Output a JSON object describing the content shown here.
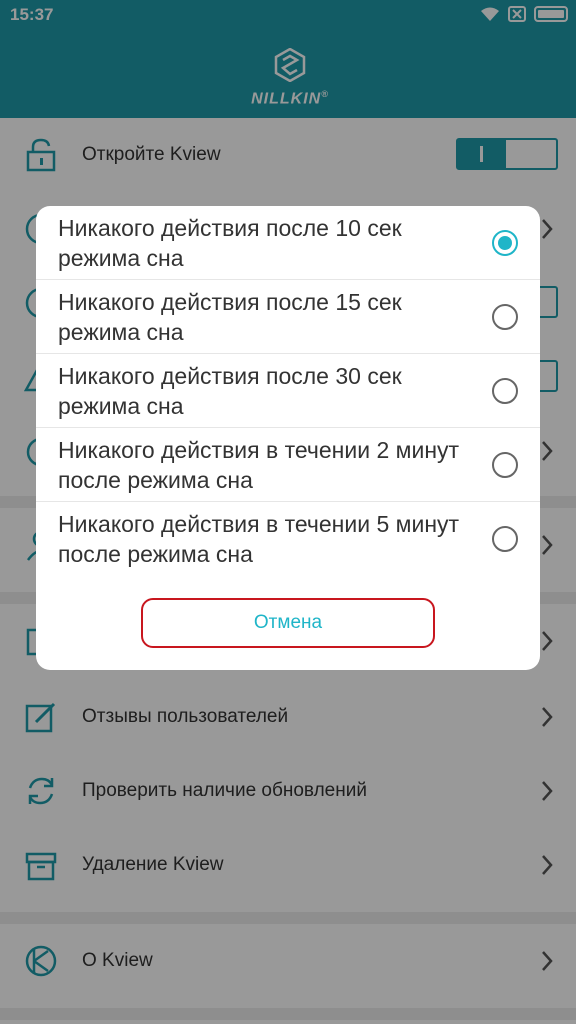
{
  "status_bar": {
    "time": "15:37",
    "icons": [
      "wifi-icon",
      "sim-none-icon",
      "battery-icon"
    ]
  },
  "header": {
    "logo_text": "NILLKIN",
    "logo_mark": "®"
  },
  "settings": {
    "items": [
      {
        "icon": "lock-icon",
        "label": "Откройте Kview",
        "control": "toggle",
        "toggle_on": true
      },
      {
        "icon": "clock-icon",
        "label": "",
        "control": "chevron"
      },
      {
        "icon": "alarm-icon",
        "label": "",
        "control": "toggle"
      },
      {
        "icon": "warning-icon",
        "label": "",
        "control": "toggle"
      },
      {
        "icon": "alarm-clock-icon",
        "label": "",
        "control": "chevron"
      },
      {
        "icon": "person-icon",
        "label": "",
        "control": "chevron"
      },
      {
        "icon": "puzzle-icon",
        "label": "",
        "control": "chevron"
      },
      {
        "icon": "edit-icon",
        "label": "Отзывы пользователей",
        "control": "chevron"
      },
      {
        "icon": "refresh-icon",
        "label": "Проверить наличие обновлений",
        "control": "chevron"
      },
      {
        "icon": "archive-icon",
        "label": "Удаление Kview",
        "control": "chevron"
      },
      {
        "icon": "kview-logo-icon",
        "label": "О Kview",
        "control": "chevron"
      }
    ]
  },
  "dialog": {
    "options": [
      {
        "text": "Никакого действия после 10 сек режима сна",
        "selected": true
      },
      {
        "text": "Никакого действия после 15 сек режима сна",
        "selected": false
      },
      {
        "text": "Никакого действия после 30 сек режима сна",
        "selected": false
      },
      {
        "text": "Никакого действия в течении 2 минут после режима сна",
        "selected": false
      },
      {
        "text": "Никакого действия в течении 5 минут после режима сна",
        "selected": false
      }
    ],
    "cancel_label": "Отмена"
  },
  "colors": {
    "accent": "#1f9aa8",
    "radio_selected": "#1fb5c8",
    "cancel_border": "#c8161e"
  }
}
